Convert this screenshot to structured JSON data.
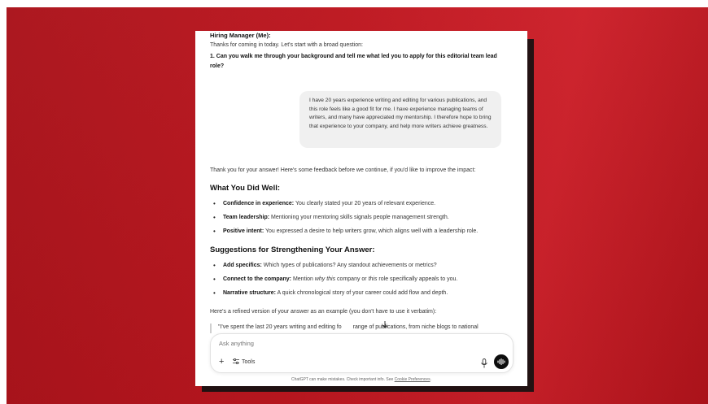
{
  "chat": {
    "hiring_manager_name": "Hiring Manager (Me):",
    "intro": "Thanks for coming in today. Let's start with a broad question:",
    "question": "1. Can you walk me through your background and tell me what led you to apply for this editorial team lead role?",
    "user_answer": "I have 20 years experience writing and editing for various publications, and this role feels like a good fit for me. I have experience managing teams of writers, and many have appreciated my mentorship. I therefore hope to bring that experience to your company, and help more writers achieve greatness.",
    "response_intro": "Thank you for your answer! Here's some feedback before we continue, if you'd like to improve the impact:",
    "well_heading": "What You Did Well:",
    "well_items": [
      {
        "label": "Confidence in experience:",
        "text": " You clearly stated your 20 years of relevant experience."
      },
      {
        "label": "Team leadership:",
        "text": " Mentioning your mentoring skills signals people management strength."
      },
      {
        "label": "Positive intent:",
        "text": " You expressed a desire to help writers grow, which aligns well with a leadership role."
      }
    ],
    "sugg_heading": "Suggestions for Strengthening Your Answer:",
    "sugg_items": [
      {
        "label": "Add specifics:",
        "text": " Which types of publications? Any standout achievements or metrics?"
      },
      {
        "label": "Connect to the company:",
        "text_before": " Mention ",
        "em1": "why this",
        "text_mid": " company or ",
        "em2": "this",
        "text_after": " role specifically appeals to you."
      },
      {
        "label": "Narrative structure:",
        "text": " A quick chronological story of your career could add flow and depth."
      }
    ],
    "refined_intro": "Here's a refined version of your answer as an example (you don't have to use it verbatim):",
    "quote_before": "\"I've spent the last 20 years writing and editing fo",
    "quote_after": " range of publications, from niche blogs to national"
  },
  "composer": {
    "placeholder": "Ask anything",
    "tools_label": "Tools"
  },
  "footer": {
    "text": "ChatGPT can make mistakes. Check important info. See ",
    "link": "Cookie Preferences",
    "end": "."
  },
  "icons": {
    "plus": "plus-icon",
    "tools": "sliders-icon",
    "scroll": "arrow-down-icon",
    "mic": "microphone-icon",
    "voice": "voice-mode-icon"
  },
  "colors": {
    "background_red": "#c0151e",
    "voice_button": "#0d0d0d",
    "bubble": "#f0f0f0"
  }
}
